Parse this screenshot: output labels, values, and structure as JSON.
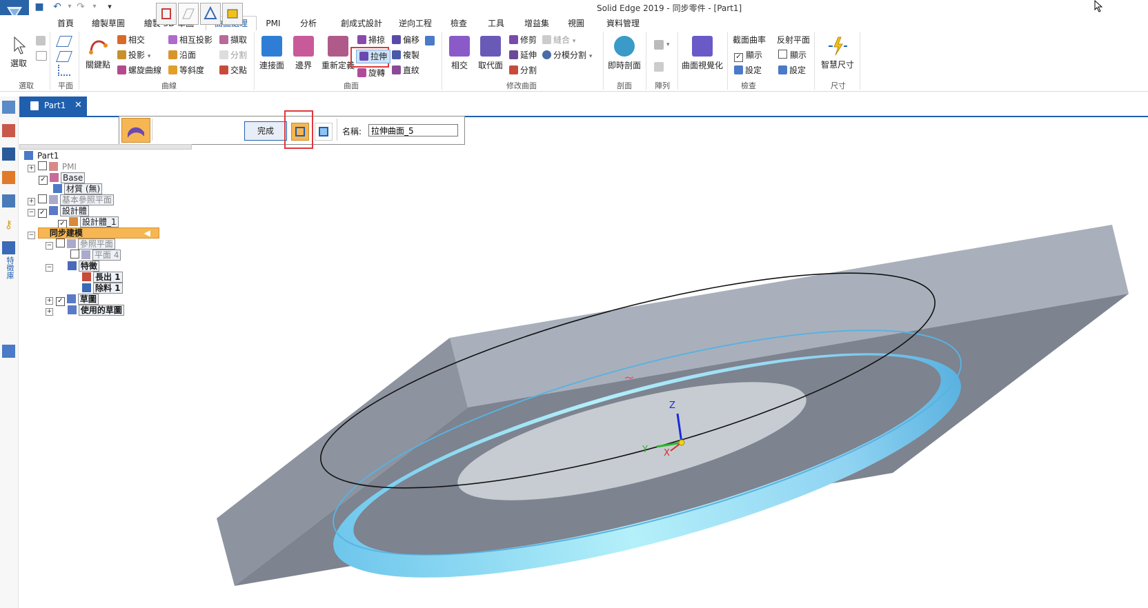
{
  "window": {
    "title": "Solid Edge 2019 - 同步零件 - [Part1]"
  },
  "quick_access": {
    "save": "save-icon",
    "undo": "undo-icon",
    "redo": "redo-icon",
    "customize": "▾"
  },
  "tabs": [
    "首頁",
    "繪製草圖",
    "繪製 3D 草圖",
    "曲面處理",
    "PMI",
    "分析",
    "創成式設計",
    "逆向工程",
    "檢查",
    "工具",
    "增益集",
    "視圖",
    "資料管理"
  ],
  "active_tab": "曲面處理",
  "ribbon": {
    "select": {
      "button": "選取",
      "group": "選取"
    },
    "plane": {
      "group": "平面"
    },
    "curves": {
      "keypoints": "關鍵點",
      "intersect": "相交",
      "project": "投影",
      "helix": "螺旋曲線",
      "cross_project": "相互投影",
      "along": "沿面",
      "isocline": "等斜度",
      "extract": "擷取",
      "split": "分割",
      "intersection_point": "交點",
      "group": "曲線"
    },
    "surfaces": {
      "blue_surf": "連接面",
      "bounded": "邊界",
      "redefine": "重新定義",
      "sweep": "掃掠",
      "extrude": "拉伸",
      "revolve": "旋轉",
      "offset": "偏移",
      "copy": "複製",
      "ruled": "直紋",
      "group": "曲面"
    },
    "modify": {
      "intersect": "相交",
      "replace": "取代面",
      "trim": "修剪",
      "extend": "延伸",
      "split": "分割",
      "stitch": "縫合",
      "parting_split": "分模分割",
      "group": "修改曲面"
    },
    "section": {
      "button": "即時剖面",
      "group": "剖面"
    },
    "pattern": {
      "group": "陣列"
    },
    "surface_viz": {
      "button": "曲面視覺化"
    },
    "inspect": {
      "curvature": "截面曲率",
      "show1": "顯示",
      "settings1": "設定",
      "reflect": "反射平面",
      "show2": "顯示",
      "settings2": "設定",
      "group": "檢查"
    },
    "dimension": {
      "button": "智慧尺寸",
      "group": "尺寸"
    }
  },
  "doc_tab": {
    "label": "Part1",
    "close": "✕"
  },
  "left_bar": {
    "feature_library": "特徵庫"
  },
  "command_bar": {
    "finish": "完成",
    "name_label": "名稱:",
    "name_value": "拉伸曲面_5"
  },
  "tree": {
    "root": "Part1",
    "pmi": "PMI",
    "base": "Base",
    "material": "材質 (無)",
    "base_planes": "基本參照平面",
    "design_body": "設計體",
    "design_body_1": "設計體_1",
    "sync": "同步建模",
    "ref_planes": "參照平面",
    "plane4": "平面 4",
    "features": "特徵",
    "extrude1": "長出 1",
    "cutout1": "除料 1",
    "sketches": "草圖",
    "used_sketches": "使用的草圖"
  },
  "triad": {
    "z": "Z",
    "y": "Y",
    "x": "X"
  },
  "colors": {
    "accent": "#1f5fae",
    "highlight": "#e0373b",
    "solid_top": "#a9b0bc",
    "solid_side": "#7d838f",
    "surface": "#8fd3f2"
  }
}
